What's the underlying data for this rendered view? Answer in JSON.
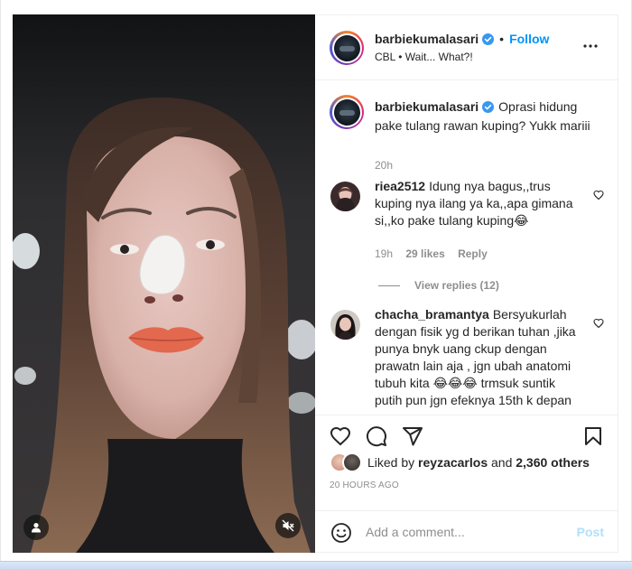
{
  "post": {
    "author": {
      "username": "barbiekumalasari",
      "verified": true,
      "follow_label": "Follow",
      "subtitle": "CBL • Wait... What?!"
    },
    "caption": {
      "username": "barbiekumalasari",
      "text": "Oprasi hidung pake tulang rawan kuping? Yukk mariii",
      "time": "20h"
    },
    "comments": [
      {
        "username": "riea2512",
        "text": "Idung nya bagus,,trus kuping nya ilang ya ka,,apa gimana si,,ko pake tulang kuping😂",
        "time": "19h",
        "likes": "29 likes",
        "reply_label": "Reply",
        "view_replies": "View replies (12)"
      },
      {
        "username": "chacha_bramantya",
        "text": "Bersyukurlah dengan fisik yg d berikan tuhan ,jika punya bnyk uang ckup dengan prawatn lain aja , jgn ubah anatomi tubuh kita 😂😂😂 trmsuk suntik putih pun jgn efeknya 15th k depan"
      }
    ],
    "liked_by": {
      "prefix": "Liked by ",
      "user": "reyzacarlos",
      "middle": " and ",
      "others": "2,360 others"
    },
    "time_ago": "20 HOURS AGO",
    "comment_box": {
      "placeholder": "Add a comment...",
      "post_label": "Post"
    },
    "icons": {
      "like": "heart-icon",
      "comment": "comment-icon",
      "share": "paper-plane-icon",
      "save": "bookmark-icon",
      "more": "more-dots-icon",
      "emoji": "emoji-icon",
      "mute": "muted-speaker-icon",
      "tagged": "user-tag-icon"
    },
    "colors": {
      "accent": "#0095f6",
      "verified": "#3897f0",
      "muted_text": "#8e8e8e",
      "post_disabled": "#b2dffc"
    }
  }
}
